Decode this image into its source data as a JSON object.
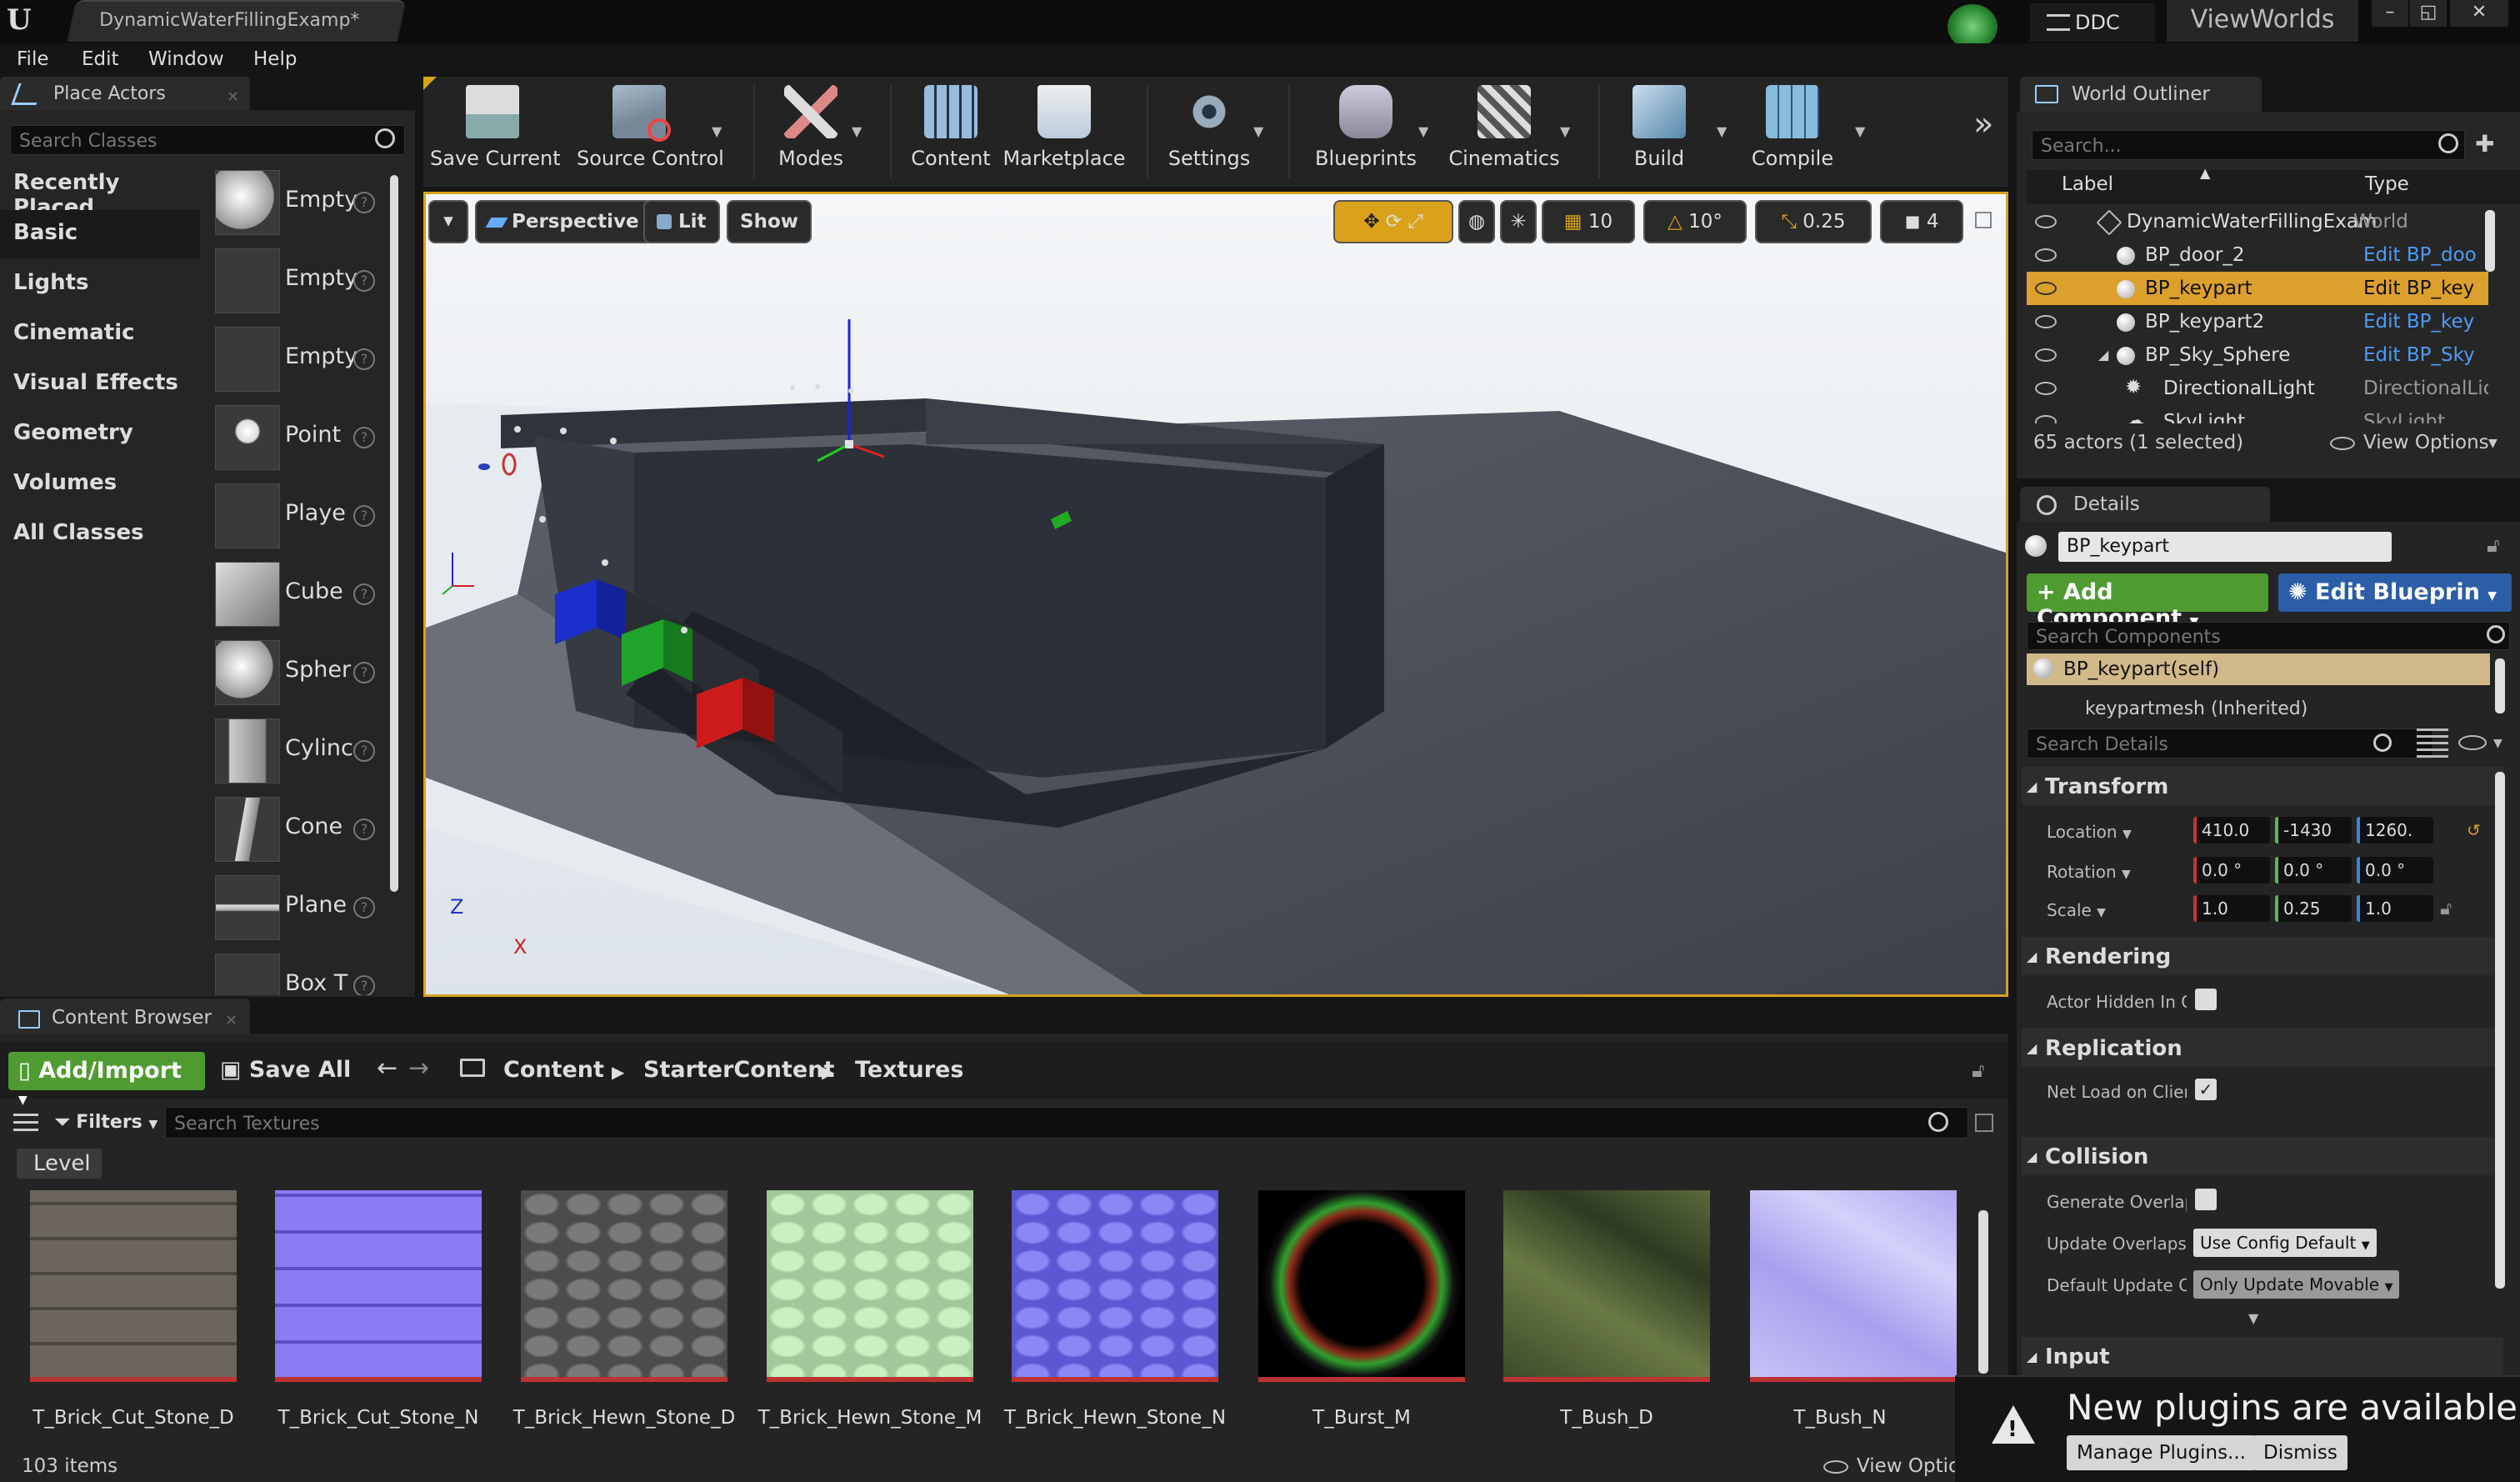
{
  "titlebar": {
    "tab": "DynamicWaterFillingExamp*",
    "ddc": "DDC",
    "viewworlds": "ViewWorlds",
    "min": "–",
    "restore": "◱",
    "close": "✕",
    "logo": "U"
  },
  "menu": [
    "File",
    "Edit",
    "Window",
    "Help"
  ],
  "place_actors": {
    "title": "Place Actors",
    "search_placeholder": "Search Classes",
    "categories": [
      "Recently Placed",
      "Basic",
      "Lights",
      "Cinematic",
      "Visual Effects",
      "Geometry",
      "Volumes",
      "All Classes"
    ],
    "selected_category": "Basic",
    "actors": [
      "Empty",
      "Empty",
      "Empty",
      "Point",
      "Playe",
      "Cube",
      "Spher",
      "Cylinc",
      "Cone",
      "Plane",
      "Box T"
    ]
  },
  "toolbar": [
    "Save Current",
    "Source Control",
    "Modes",
    "Content",
    "Marketplace",
    "Settings",
    "Blueprints",
    "Cinematics",
    "Build",
    "Compile"
  ],
  "viewport": {
    "perspective": "Perspective",
    "lit": "Lit",
    "show": "Show",
    "grid_snap": "10",
    "rot_snap": "10°",
    "scale_snap": "0.25",
    "cam_speed": "4",
    "axis_z": "Z",
    "axis_x": "X"
  },
  "world_outliner": {
    "title": "World Outliner",
    "search_placeholder": "Search...",
    "col_label": "Label",
    "col_type": "Type",
    "rows": [
      {
        "label": "DynamicWaterFillingExam",
        "type": "World",
        "link": false
      },
      {
        "label": "BP_door_2",
        "type": "Edit BP_doo",
        "link": true
      },
      {
        "label": "BP_keypart",
        "type": "Edit BP_key",
        "link": true,
        "selected": true
      },
      {
        "label": "BP_keypart2",
        "type": "Edit BP_key",
        "link": true
      },
      {
        "label": "BP_Sky_Sphere",
        "type": "Edit BP_Sky",
        "link": true
      },
      {
        "label": "DirectionalLight",
        "type": "DirectionalLic",
        "link": false
      },
      {
        "label": "SkyLight",
        "type": "SkyLight",
        "link": false
      }
    ],
    "count": "65 actors (1 selected)",
    "view_options": "View Options"
  },
  "details": {
    "title": "Details",
    "name": "BP_keypart",
    "add_component": "+ Add Component",
    "edit_blueprint": "Edit Blueprin",
    "search_components": "Search Components",
    "self": "BP_keypart(self)",
    "mesh": "keypartmesh (Inherited)",
    "search_details": "Search Details",
    "transform": {
      "title": "Transform",
      "location_label": "Location",
      "rotation_label": "Rotation",
      "scale_label": "Scale",
      "location": [
        "410.0",
        "-1430",
        "1260."
      ],
      "rotation": [
        "0.0 °",
        "0.0 °",
        "0.0 °"
      ],
      "scale": [
        "1.0",
        "0.25",
        "1.0"
      ]
    },
    "rendering": {
      "title": "Rendering",
      "actor_hidden": "Actor Hidden In G"
    },
    "replication": {
      "title": "Replication",
      "net_load": "Net Load on Clien",
      "checkmark": "✓"
    },
    "collision": {
      "title": "Collision",
      "generate_overlap": "Generate Overlap",
      "update_overlaps": "Update Overlaps I",
      "update_overlaps_value": "Use Config Default",
      "default_update": "Default Update O",
      "default_update_value": "Only Update Movable"
    },
    "input": {
      "title": "Input"
    }
  },
  "content_browser": {
    "title": "Content Browser",
    "add_import": "Add/Import",
    "save_all": "Save All",
    "path": [
      "Content",
      "StarterContent",
      "Textures"
    ],
    "filters": "Filters",
    "search_placeholder": "Search Textures",
    "level": "Level",
    "assets": [
      "T_Brick_Cut_Stone_D",
      "T_Brick_Cut_Stone_N",
      "T_Brick_Hewn_Stone_D",
      "T_Brick_Hewn_Stone_M",
      "T_Brick_Hewn_Stone_N",
      "T_Burst_M",
      "T_Bush_D",
      "T_Bush_N"
    ],
    "items": "103 items",
    "view_options": "View Optio"
  },
  "notification": {
    "title": "New plugins are available",
    "manage": "Manage Plugins...",
    "dismiss": "Dismiss",
    "warning": "!"
  },
  "colors": {
    "accent": "#d9a21a",
    "green_button": "#4f9b32",
    "blue_button": "#2b5ea7",
    "link": "#4d9cf5"
  }
}
